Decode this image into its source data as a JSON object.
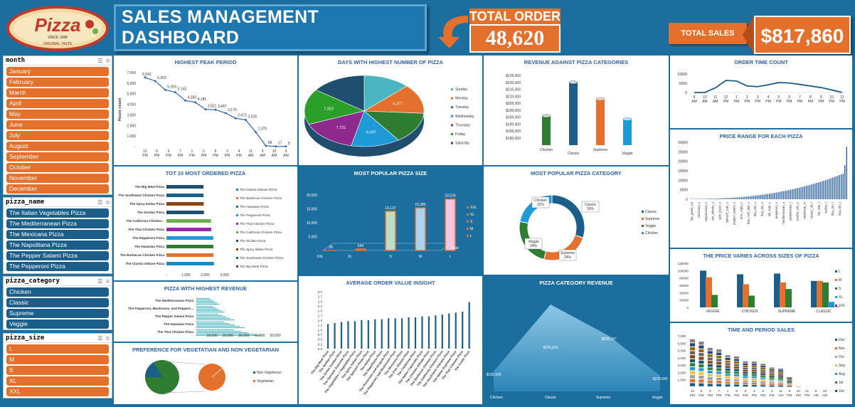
{
  "header": {
    "logo_text": "Pizza",
    "logo_sub": "ORIGINAL TASTE",
    "logo_year": "SINCE 1988",
    "title": "SALES MANAGEMENT DASHBOARD",
    "total_order_label": "TOTAL ORDER",
    "total_order_value": "48,620",
    "total_sales_label": "TOTAL SALES",
    "total_sales_value": "$817,860"
  },
  "colors": {
    "orange": "#e3712d",
    "blue": "#1c6e9e",
    "dark_blue": "#1c5e8a",
    "teal": "#4bb5c1",
    "green": "#2e7d32"
  },
  "slicers": {
    "month": {
      "label": "month",
      "items": [
        "January",
        "February",
        "March",
        "April",
        "May",
        "June",
        "July",
        "August",
        "September",
        "October",
        "November",
        "December"
      ]
    },
    "pizza_name": {
      "label": "pizza_name",
      "items": [
        "The Italian Vegetables Pizza",
        "The Mediterranean Pizza",
        "The Mexicana Pizza",
        "The Napolitana Pizza",
        "The Pepper Salami Pizza",
        "The Pepperoni Pizza"
      ]
    },
    "pizza_category": {
      "label": "pizza_category",
      "items": [
        "Chicken",
        "Classic",
        "Supreme",
        "Veggie"
      ]
    },
    "pizza_size": {
      "label": "pizza_size",
      "items": [
        "L",
        "M",
        "S",
        "XL",
        "XXL"
      ]
    }
  },
  "panels": {
    "peak": {
      "title": "HIGHEST PEAK PERIOD"
    },
    "days": {
      "title": "DAYS WITH HIGHEST NUMBER OF PIZZA"
    },
    "rev_cat": {
      "title": "REVENUE AGAINST PIZZA CATEGORIES"
    },
    "order_time": {
      "title": "ORDER TIME COUNT"
    },
    "top10": {
      "title": "TOT 10 MOST ORDERED PIZZA"
    },
    "size": {
      "title": "MOST POPULAR PIZZA SIZE"
    },
    "category": {
      "title": "MOST POPULAR PIZZA CATEGORY"
    },
    "price_range": {
      "title": "PRICE RANGE FOR EACH PIZZA"
    },
    "high_rev": {
      "title": "PIZZA WITH HIGHEST REVENUE"
    },
    "aov": {
      "title": "AVERAGE ORDER VALUE INSIGHT"
    },
    "cat_rev": {
      "title": "PIZZA CATEGORY REVENUE"
    },
    "price_size": {
      "title": "THE PRICE VARIES ACROSS SIZES OF PIZZA"
    },
    "veg": {
      "title": "PREFERENCE FOR VEGETATIAN AND NON VEGETARIAN"
    },
    "time_period": {
      "title": "TIME AND PERIOD SALES"
    }
  },
  "chart_data": [
    {
      "id": "peak",
      "type": "line",
      "ylabel": "Hours count",
      "x": [
        "12 PM",
        "6 PM",
        "5 PM",
        "7 PM",
        "1 PM",
        "2 PM",
        "8 PM",
        "3 PM",
        "4 PM",
        "9 AM",
        "11 AM",
        "9 AM",
        "10 AM",
        "9 AM"
      ],
      "x_ticks": [
        "12 PM",
        "6 PM",
        "5 PM",
        "7 PM",
        "1 PM",
        "2 PM",
        "8 PM",
        "3 PM",
        "4 PM",
        "11 AM",
        "9 AM",
        "10 AM",
        "9 AM"
      ],
      "values": [
        6543,
        6203,
        5359,
        5143,
        4350,
        4185,
        3521,
        3487,
        3170,
        2672,
        2528,
        1370,
        68,
        17,
        8
      ],
      "data_labels": [
        "6,543",
        "6,203",
        "5,359",
        "5,143",
        "4,350",
        "4,185",
        "3,521",
        "3,487",
        "3,170",
        "2,672",
        "2,528",
        "1,370",
        "68",
        "17",
        "8"
      ],
      "ylim": [
        0,
        7000
      ],
      "yticks": [
        "7,000",
        "6,000",
        "5,000",
        "4,000",
        "3,000",
        "2,000",
        "1,000",
        "-"
      ]
    },
    {
      "id": "days",
      "type": "pie",
      "categories": [
        "Sunday",
        "Monday",
        "Tuesday",
        "Wednesday",
        "Thursday",
        "Friday",
        "Saturday"
      ],
      "colors": [
        "#4bb5c1",
        "#e3712d",
        "#2e7d32",
        "#1e9ad6",
        "#8e2a8e",
        "#2aa02a",
        "#1f4e6e"
      ],
      "values": [
        6035,
        6377,
        6753,
        6307,
        7323,
        7721,
        7104
      ],
      "visible_labels": [
        "6,377",
        "6,307",
        "7,721",
        "7,323"
      ]
    },
    {
      "id": "rev_cat",
      "type": "bar",
      "categories": [
        "Chicken",
        "Classic",
        "Supreme",
        "Veggie"
      ],
      "values": [
        195920,
        220053,
        208197,
        193690
      ],
      "ylim": [
        180000,
        225000
      ],
      "yticks": [
        "$225,000",
        "$220,000",
        "$215,000",
        "$210,000",
        "$205,000",
        "$200,000",
        "$195,000",
        "$190,000",
        "$185,000",
        "$180,000"
      ],
      "colors": [
        "#2e7d32",
        "#1c5e8a",
        "#e3712d",
        "#1e9ad6"
      ]
    },
    {
      "id": "order_time",
      "type": "line",
      "x": [
        "9 AM",
        "10 AM",
        "11 AM",
        "12 PM",
        "1 PM",
        "2 PM",
        "3 PM",
        "4 PM",
        "5 PM",
        "6 PM",
        "7 PM",
        "8 PM",
        "9 PM",
        "10 PM",
        "11 PM"
      ],
      "values": [
        8,
        17,
        2528,
        6543,
        6203,
        3521,
        3170,
        4185,
        5359,
        5143,
        4350,
        3487,
        2672,
        1370,
        68
      ],
      "yticks": [
        "10000",
        "5000",
        "0"
      ]
    },
    {
      "id": "top10",
      "type": "bar",
      "orientation": "horizontal",
      "categories": [
        "The Big Meat Pizza",
        "The Southwest Chicken Pizza",
        "The Spicy Italian Pizza",
        "The Sicilian Pizza",
        "The California Chicken...",
        "The Thai Chicken Pizza",
        "The Pepperoni Pizza",
        "The Hawaiian Pizza",
        "The Barbecue Chicken Pizza",
        "The Classic Deluxe Pizza"
      ],
      "values": [
        1914,
        1917,
        1924,
        1938,
        2302,
        2315,
        2418,
        2422,
        2432,
        2453
      ],
      "colors": [
        "#1f4e6e",
        "#1c5e8a",
        "#8b4513",
        "#1f4e6e",
        "#6ab04c",
        "#9b27a6",
        "#1e9ad6",
        "#2e7d32",
        "#e3712d",
        "#1c8ac2"
      ],
      "legend": [
        "The Classic Deluxe Pizza",
        "The Barbecue Chicken Pizza",
        "The Hawaiian Pizza",
        "The Pepperoni Pizza",
        "The Thai Chicken Pizza",
        "The California Chicken Pizza",
        "The Sicilian Pizza",
        "The Spicy Italian Pizza",
        "The Southwest Chicken Pizza",
        "The Big Meat Pizza"
      ],
      "xticks": [
        "-",
        "1,000",
        "2,000",
        "3,000"
      ]
    },
    {
      "id": "size",
      "type": "bar",
      "categories": [
        "XXL",
        "XL",
        "S",
        "M",
        "L"
      ],
      "values": [
        28,
        544,
        14137,
        15385,
        18526
      ],
      "data_labels": [
        "28",
        "544",
        "14,137",
        "15,385",
        "18,526"
      ],
      "xlabel": "Total",
      "ylim": [
        0,
        20000
      ],
      "yticks": [
        "20,000",
        "15,000",
        "10,000",
        "5,000",
        "-"
      ],
      "legend": [
        "XXL",
        "XL",
        "S",
        "M",
        "L"
      ]
    },
    {
      "id": "category",
      "type": "pie",
      "style": "donut",
      "categories": [
        "Classic",
        "Supreme",
        "Veggie",
        "Chicken"
      ],
      "values": [
        30,
        24,
        24,
        22
      ],
      "labels": [
        "Classic 30%",
        "Supreme 24%",
        "Veggie 24%",
        "Chicken 22%"
      ],
      "colors": [
        "#1c5e8a",
        "#e3712d",
        "#2e7d32",
        "#1e9ad6"
      ]
    },
    {
      "id": "price_range",
      "type": "bar",
      "yticks": [
        "30000",
        "25000",
        "20000",
        "15000",
        "10000",
        "5000",
        "0"
      ],
      "x_labels": [
        "the_greek_xxl",
        "mexicana_s",
        "soppressata_s",
        "ckn_alfredo_s",
        "spin_pesto_s",
        "spinach_supr_s",
        "pepper_salami_s",
        "prsc_argla_s",
        "pep_msh_pep_s",
        "bbq_ckn_s",
        "thai_ckn_s",
        "ital_supr_s",
        "pepperoni_s",
        "mediterranean_s",
        "soppressata_l",
        "southw_ckn_s",
        "calabrese_m",
        "classic_dlx_l",
        "ital_supr_l",
        "sicilian_l",
        "bbq_ckn_l",
        "thai_ckn_l"
      ],
      "values": [
        100,
        600,
        1000,
        1500,
        1800,
        2100,
        2400,
        2700,
        3100,
        3500,
        4000,
        4500,
        5200,
        5800,
        6500,
        7200,
        8000,
        9500,
        11000,
        13500,
        17000,
        27500
      ]
    },
    {
      "id": "high_rev",
      "type": "bar",
      "orientation": "horizontal",
      "categories": [
        "The Mediterranean Pizza",
        "The Pepperoni, Mushroom, and Peppers...",
        "The Pepper Salami Pizza",
        "The Hawaiian Pizza",
        "The Thai Chicken Pizza"
      ],
      "values": [
        15360,
        18834,
        25529,
        32273,
        43434
      ],
      "xticks": [
        "-",
        "10,000",
        "20,000",
        "30,000",
        "40,000",
        "50,000"
      ]
    },
    {
      "id": "aov",
      "type": "bar",
      "ylim": [
        0,
        3
      ],
      "yticks": [
        "3.0",
        "2.7",
        "2.5",
        "2.2",
        "2.0",
        "1.7",
        "1.5",
        "1.2",
        "1.0",
        "0.7",
        "0.5",
        "0.2",
        "0.0"
      ],
      "categories": [
        "The Big Meat Pizza",
        "The Sicilian Pizza",
        "The Green Garden Pizza",
        "The Spinach Supreme Pizza",
        "The Vegetables + Vegetables Pizza",
        "The Spicy Italian Pizza",
        "The Spinach Pesto Pizza",
        "The Italian Pizza",
        "The Napolitana Pizza",
        "The Prosciutto and Arugula Pizza",
        "The Pepperoni and Mushroom Pizza",
        "The Mexicana Pizza",
        "The Five Cheese Pizza",
        "The Calabrese Pizza",
        "The Italian Capocollo Pizza",
        "The Chicken Alfredo Pizza",
        "The Barbecue Chicken Pizza",
        "The California Chicken Pizza",
        "The Southwest Chicken Pizza",
        "The Italian Supreme Pizza",
        "The Thai Chicken Pizza",
        "The Greek Pizza"
      ],
      "values": [
        1.3,
        1.35,
        1.4,
        1.45,
        1.45,
        1.5,
        1.5,
        1.55,
        1.55,
        1.6,
        1.6,
        1.6,
        1.65,
        1.65,
        1.7,
        1.7,
        1.75,
        1.8,
        1.85,
        1.9,
        1.95,
        2.45
      ]
    },
    {
      "id": "cat_rev",
      "type": "area",
      "categories": [
        "Chicken",
        "Classic",
        "Supreme",
        "Veggie"
      ],
      "values": [
        195920,
        220053,
        208197,
        193690
      ],
      "data_labels": [
        "$195,920",
        "$220,053",
        "$208,197",
        "$193,690"
      ]
    },
    {
      "id": "price_size",
      "type": "bar",
      "categories": [
        "VEGGIE",
        "CHICKEN",
        "SUPREME",
        "CLASSIC"
      ],
      "series": [
        {
          "name": "L",
          "values": [
            100000,
            90000,
            92000,
            72000
          ],
          "color": "#1c5e8a"
        },
        {
          "name": "M",
          "values": [
            82000,
            63000,
            68000,
            72000
          ],
          "color": "#e3712d"
        },
        {
          "name": "S",
          "values": [
            34000,
            32000,
            50000,
            68000
          ],
          "color": "#2e7d32"
        },
        {
          "name": "XL",
          "values": [
            0,
            0,
            0,
            15000
          ],
          "color": "#1e9ad6"
        },
        {
          "name": "XXL",
          "values": [
            0,
            0,
            0,
            1000
          ],
          "color": "#8e2a8e"
        }
      ],
      "yticks": [
        "120000",
        "100000",
        "80000",
        "60000",
        "40000",
        "20000",
        "0"
      ]
    },
    {
      "id": "veg",
      "type": "pie",
      "categories": [
        "Non Vegeterian",
        "Vegetarian"
      ],
      "values": [
        76,
        24
      ],
      "colors": [
        "#1c5e8a",
        "#e3712d"
      ]
    },
    {
      "id": "time_period",
      "type": "bar",
      "stacked": true,
      "x": [
        "12 PM",
        "6 PM",
        "5 PM",
        "7 PM",
        "1 PM",
        "8 PM",
        "3 PM",
        "4 PM",
        "9 PM",
        "2 PM",
        "11 AM",
        "9 PM",
        "10 PM",
        "11 PM",
        "9 AM",
        "10 AM"
      ],
      "legend": [
        "Dec",
        "Nov",
        "Oct",
        "Sep",
        "Aug",
        "Jul",
        "Jun"
      ],
      "totals": [
        6543,
        6203,
        5359,
        5143,
        4350,
        4185,
        3521,
        3487,
        3170,
        2672,
        2528,
        1370,
        68,
        17,
        8,
        8
      ],
      "yticks": [
        "7,000",
        "6,000",
        "5,000",
        "4,000",
        "3,000",
        "2,000",
        "1,000",
        "-"
      ]
    }
  ]
}
